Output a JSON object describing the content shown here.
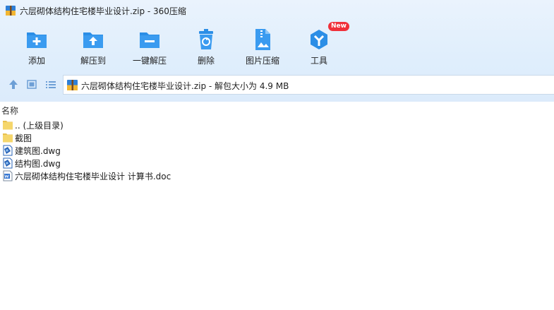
{
  "window": {
    "title": "六层砌体结构住宅楼毕业设计.zip - 360压缩"
  },
  "toolbar": {
    "items": [
      {
        "label": "添加",
        "icon": "add-folder-icon"
      },
      {
        "label": "解压到",
        "icon": "extract-to-icon"
      },
      {
        "label": "一键解压",
        "icon": "one-click-extract-icon"
      },
      {
        "label": "删除",
        "icon": "delete-trash-icon"
      },
      {
        "label": "图片压缩",
        "icon": "image-compress-icon"
      },
      {
        "label": "工具",
        "icon": "tools-icon",
        "badge": "New"
      }
    ]
  },
  "address": {
    "text": "六层砌体结构住宅楼毕业设计.zip - 解包大小为 4.9 MB"
  },
  "list": {
    "column_header": "名称",
    "files": [
      {
        "name": ".. (上级目录)",
        "icon": "parent-folder-icon"
      },
      {
        "name": "截图",
        "icon": "folder-icon"
      },
      {
        "name": "建筑图.dwg",
        "icon": "dwg-file-icon"
      },
      {
        "name": "结构图.dwg",
        "icon": "dwg-file-icon"
      },
      {
        "name": "六层砌体结构住宅楼毕业设计 计算书.doc",
        "icon": "doc-file-icon"
      }
    ]
  },
  "colors": {
    "accent_blue": "#2b8ee6",
    "badge_red": "#f0303a",
    "folder_yellow": "#f5d66b"
  }
}
